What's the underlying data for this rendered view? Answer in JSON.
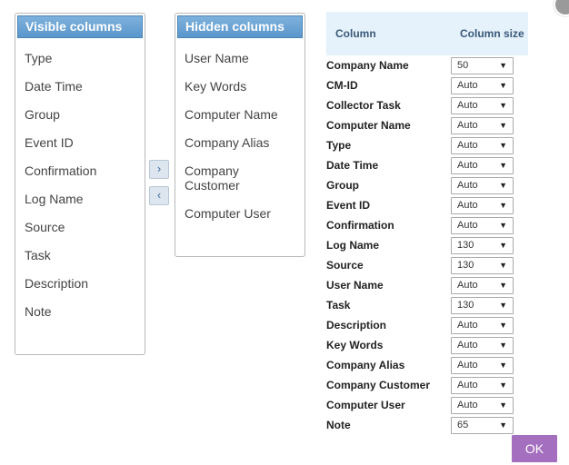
{
  "close_icon": "close-icon",
  "visible": {
    "header": "Visible columns",
    "items": [
      "Type",
      "Date Time",
      "Group",
      "Event ID",
      "Confirmation",
      "Log Name",
      "Source",
      "Task",
      "Description",
      "Note"
    ]
  },
  "hidden": {
    "header": "Hidden columns",
    "items": [
      "User Name",
      "Key Words",
      "Computer Name",
      "Company Alias",
      "Company\nCustomer",
      "Computer User"
    ]
  },
  "buttons": {
    "move_right": "›",
    "move_left": "‹",
    "ok": "OK"
  },
  "settings": {
    "col_column": "Column",
    "col_size": "Column size",
    "rows": [
      {
        "name": "Company Name",
        "size": "50"
      },
      {
        "name": "CM-ID",
        "size": "Auto"
      },
      {
        "name": "Collector Task",
        "size": "Auto"
      },
      {
        "name": "Computer Name",
        "size": "Auto"
      },
      {
        "name": "Type",
        "size": "Auto"
      },
      {
        "name": "Date Time",
        "size": "Auto"
      },
      {
        "name": "Group",
        "size": "Auto"
      },
      {
        "name": "Event ID",
        "size": "Auto"
      },
      {
        "name": "Confirmation",
        "size": "Auto"
      },
      {
        "name": "Log Name",
        "size": "130"
      },
      {
        "name": "Source",
        "size": "130"
      },
      {
        "name": "User Name",
        "size": "Auto"
      },
      {
        "name": "Task",
        "size": "130"
      },
      {
        "name": "Description",
        "size": "Auto"
      },
      {
        "name": "Key Words",
        "size": "Auto"
      },
      {
        "name": "Company Alias",
        "size": "Auto"
      },
      {
        "name": "Company Customer",
        "size": "Auto"
      },
      {
        "name": "Computer User",
        "size": "Auto"
      },
      {
        "name": "Note",
        "size": "65"
      }
    ]
  },
  "colors": {
    "header_blue": "#5a96cb",
    "ok_purple": "#a46fbe",
    "table_header_bg": "#e5f1fb"
  }
}
